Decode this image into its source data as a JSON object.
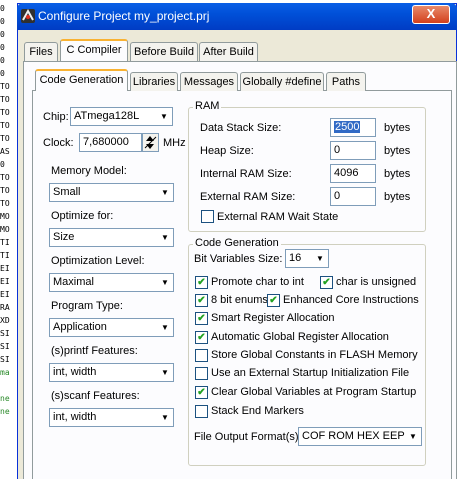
{
  "background_code": [
    "0",
    "0",
    "0",
    "0",
    "0",
    "0",
    "TO",
    "TO",
    "TO",
    "TO",
    "TO",
    "AS",
    "0",
    "TO",
    "TO",
    "TO",
    "MO",
    "MO",
    "TI",
    "TI",
    "EI",
    "EI",
    "EI",
    "RA",
    "XD",
    "SI",
    "SI",
    "SI",
    "ma",
    "",
    "ne",
    "ne"
  ],
  "window": {
    "title": "Configure Project my_project.prj",
    "close_glyph": "X"
  },
  "main_tabs": [
    "Files",
    "C Compiler",
    "Before Build",
    "After Build"
  ],
  "sub_tabs": [
    "Code Generation",
    "Libraries",
    "Messages",
    "Globally #define",
    "Paths"
  ],
  "left": {
    "chip_label": "Chip:",
    "chip_value": "ATmega128L",
    "clock_label": "Clock:",
    "clock_value": "7,680000",
    "clock_unit": "MHz",
    "memory_model_label": "Memory Model:",
    "memory_model_value": "Small",
    "optimize_for_label": "Optimize for:",
    "optimize_for_value": "Size",
    "optimization_level_label": "Optimization Level:",
    "optimization_level_value": "Maximal",
    "program_type_label": "Program Type:",
    "program_type_value": "Application",
    "sprintf_label": "(s)printf Features:",
    "sprintf_value": "int, width",
    "sscanf_label": "(s)scanf Features:",
    "sscanf_value": "int, width"
  },
  "ram": {
    "title": "RAM",
    "data_stack_label": "Data Stack Size:",
    "data_stack_value": "2500",
    "heap_label": "Heap Size:",
    "heap_value": "0",
    "internal_label": "Internal RAM Size:",
    "internal_value": "4096",
    "external_label": "External RAM Size:",
    "external_value": "0",
    "unit": "bytes",
    "wait_state_label": "External RAM Wait State",
    "wait_state_checked": false
  },
  "codegen": {
    "title": "Code Generation",
    "bitvars_label": "Bit Variables Size:",
    "bitvars_value": "16",
    "options": [
      {
        "label": "Promote char to int",
        "checked": true
      },
      {
        "label": "char is unsigned",
        "checked": true
      },
      {
        "label": "8 bit enums",
        "checked": true
      },
      {
        "label": "Enhanced Core Instructions",
        "checked": true
      },
      {
        "label": "Smart Register Allocation",
        "checked": true
      },
      {
        "label": "Automatic Global Register Allocation",
        "checked": true
      },
      {
        "label": "Store Global Constants in FLASH Memory",
        "checked": false
      },
      {
        "label": "Use an External Startup Initialization File",
        "checked": false
      },
      {
        "label": "Clear Global Variables at Program Startup",
        "checked": true
      },
      {
        "label": "Stack End Markers",
        "checked": false
      }
    ],
    "file_output_label": "File Output Format(s):",
    "file_output_value": "COF ROM HEX EEP"
  }
}
